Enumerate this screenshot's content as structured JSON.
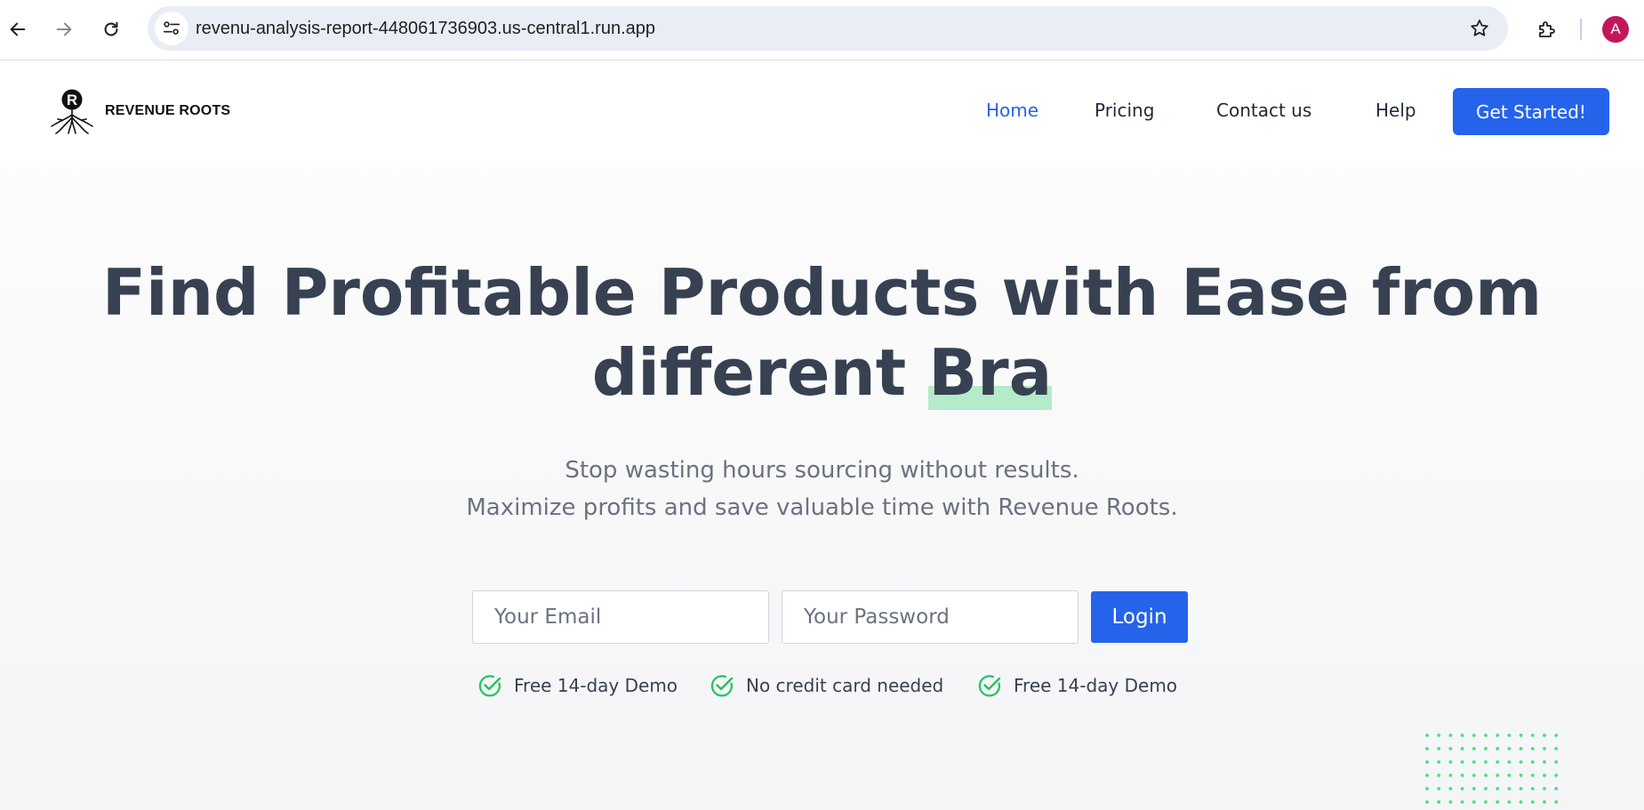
{
  "browser": {
    "url": "revenu-analysis-report-448061736903.us-central1.run.app",
    "profile_initial": "A",
    "icons": [
      "back-arrow-icon",
      "forward-arrow-icon",
      "reload-icon",
      "site-info-icon",
      "star-icon",
      "extensions-icon"
    ]
  },
  "header": {
    "brand_name": "REVENUE ROOTS",
    "brand_letter": "R",
    "nav": {
      "home": "Home",
      "pricing": "Pricing",
      "contact": "Contact us",
      "help": "Help"
    },
    "cta": "Get Started!"
  },
  "hero": {
    "title_main": "Find Profitable Products with Ease from",
    "title_line2": "different ",
    "title_highlight": "Bra",
    "subtitle_line1": "Stop wasting hours sourcing without results.",
    "subtitle_line2": "Maximize profits and save valuable time with Revenue Roots."
  },
  "login_form": {
    "email_placeholder": "Your Email",
    "password_placeholder": "Your Password",
    "login_label": "Login"
  },
  "features": [
    {
      "label": "Free 14-day Demo",
      "icon": "check-circle-icon"
    },
    {
      "label": "No credit card needed",
      "icon": "check-circle-icon"
    },
    {
      "label": "Free 14-day Demo",
      "icon": "check-circle-icon"
    }
  ],
  "colors": {
    "accent": "#2563eb",
    "check": "#22c55e",
    "highlight": "#b4ebc9",
    "heading": "#374151",
    "profile": "#c2185b"
  }
}
